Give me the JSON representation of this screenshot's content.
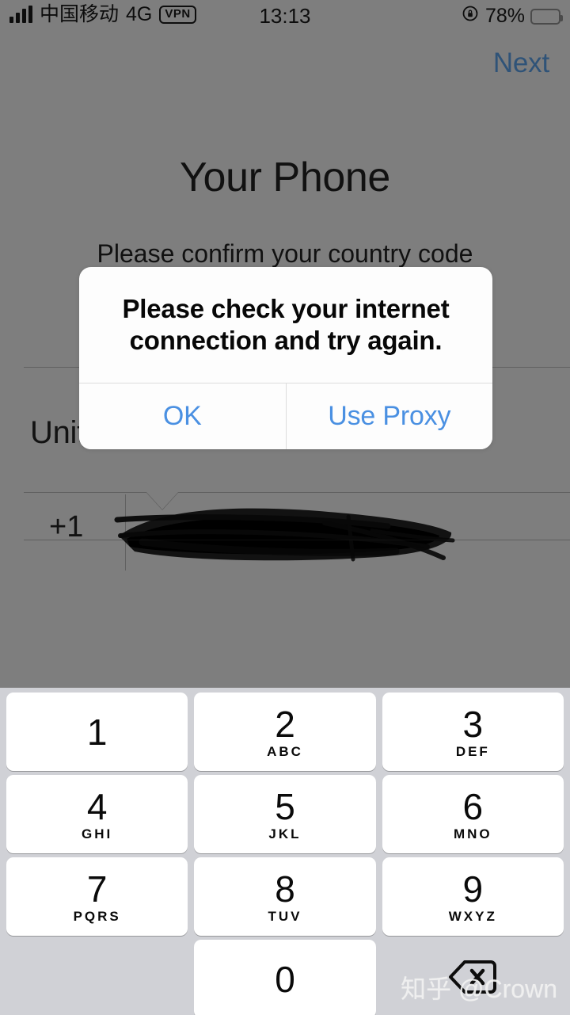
{
  "status_bar": {
    "carrier": "中国移动",
    "network": "4G",
    "vpn_badge": "VPN",
    "time": "13:13",
    "battery_percent": "78%",
    "rotation_lock_icon": "rotation-lock-icon",
    "signal_icon": "signal-bars-icon",
    "battery_icon": "battery-icon",
    "text_color": "#0d0d0d"
  },
  "app": {
    "next_label": "Next",
    "next_color": "#2f5378",
    "title": "Your Phone",
    "subtitle": "Please confirm your country code",
    "country_name": "United States",
    "dial_code": "+1",
    "phone_number_value": "",
    "phone_number_placeholder": "",
    "phone_number_redacted": true,
    "overlay_color": "#7e7e7e"
  },
  "alert": {
    "message": "Please check your internet connection and try again.",
    "ok_label": "OK",
    "proxy_label": "Use Proxy",
    "button_color": "#4a90e2",
    "background_color": "#fdfdfd"
  },
  "keypad": {
    "background_color": "#d0d1d6",
    "key_color": "#ffffff",
    "rows": [
      [
        {
          "digit": "1",
          "letters": ""
        },
        {
          "digit": "2",
          "letters": "ABC"
        },
        {
          "digit": "3",
          "letters": "DEF"
        }
      ],
      [
        {
          "digit": "4",
          "letters": "GHI"
        },
        {
          "digit": "5",
          "letters": "JKL"
        },
        {
          "digit": "6",
          "letters": "MNO"
        }
      ],
      [
        {
          "digit": "7",
          "letters": "PQRS"
        },
        {
          "digit": "8",
          "letters": "TUV"
        },
        {
          "digit": "9",
          "letters": "WXYZ"
        }
      ]
    ],
    "zero": {
      "digit": "0",
      "letters": ""
    },
    "delete_icon": "backspace-delete-icon"
  },
  "watermark": {
    "text": "知乎 @Crown"
  }
}
